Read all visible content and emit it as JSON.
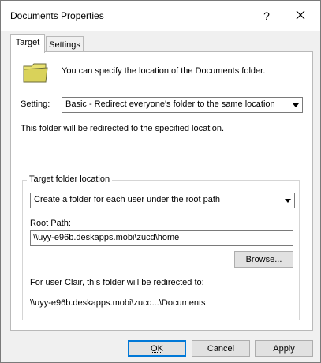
{
  "window": {
    "title": "Documents Properties",
    "help_glyph": "?"
  },
  "tabs": [
    {
      "label": "Target",
      "active": true
    },
    {
      "label": "Settings",
      "active": false
    }
  ],
  "target": {
    "intro": "You can specify the location of the Documents folder.",
    "setting_label": "Setting:",
    "setting_value": "Basic - Redirect everyone's folder to the same location",
    "redirect_text": "This folder will be redirected to the specified location.",
    "group_caption": "Target folder location",
    "location_value": "Create a folder for each user under the root path",
    "root_label": "Root Path:",
    "root_value": "\\\\uyy-e96b.deskapps.mobi\\zucd\\home",
    "browse_label": "Browse...",
    "for_user_text": "For user Clair, this folder will be redirected to:",
    "destination_path": "\\\\uyy-e96b.deskapps.mobi\\zucd...\\Documents"
  },
  "buttons": {
    "ok": "OK",
    "cancel": "Cancel",
    "apply": "Apply"
  },
  "icons": {
    "folder": "folder-icon",
    "close": "close-icon",
    "dropdown": "chevron-down-icon"
  },
  "colors": {
    "folder_fill": "#e8e170",
    "folder_stroke": "#6b6b3a",
    "default_button_border": "#0078d7"
  }
}
